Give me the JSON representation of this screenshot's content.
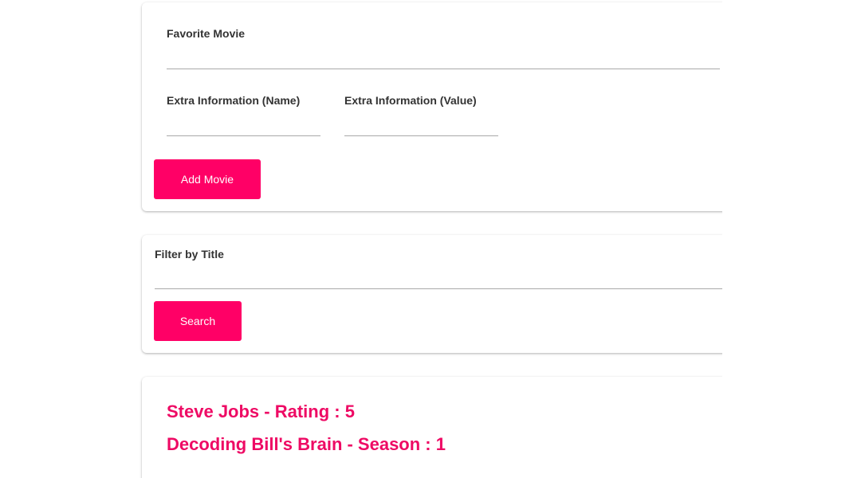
{
  "add_movie_form": {
    "favorite_movie_label": "Favorite Movie",
    "favorite_movie_value": "",
    "extra_name_label": "Extra Information (Name)",
    "extra_name_value": "",
    "extra_value_label": "Extra Information (Value)",
    "extra_value_value": "",
    "add_button_label": "Add Movie"
  },
  "filter_form": {
    "filter_label": "Filter by Title",
    "filter_value": "",
    "search_button_label": "Search"
  },
  "movie_list": {
    "items": [
      "Steve Jobs - Rating : 5",
      "Decoding Bill's Brain - Season : 1"
    ]
  },
  "colors": {
    "accent": "#ff0066",
    "list_text": "#ee0a64",
    "label_text": "#333333"
  }
}
